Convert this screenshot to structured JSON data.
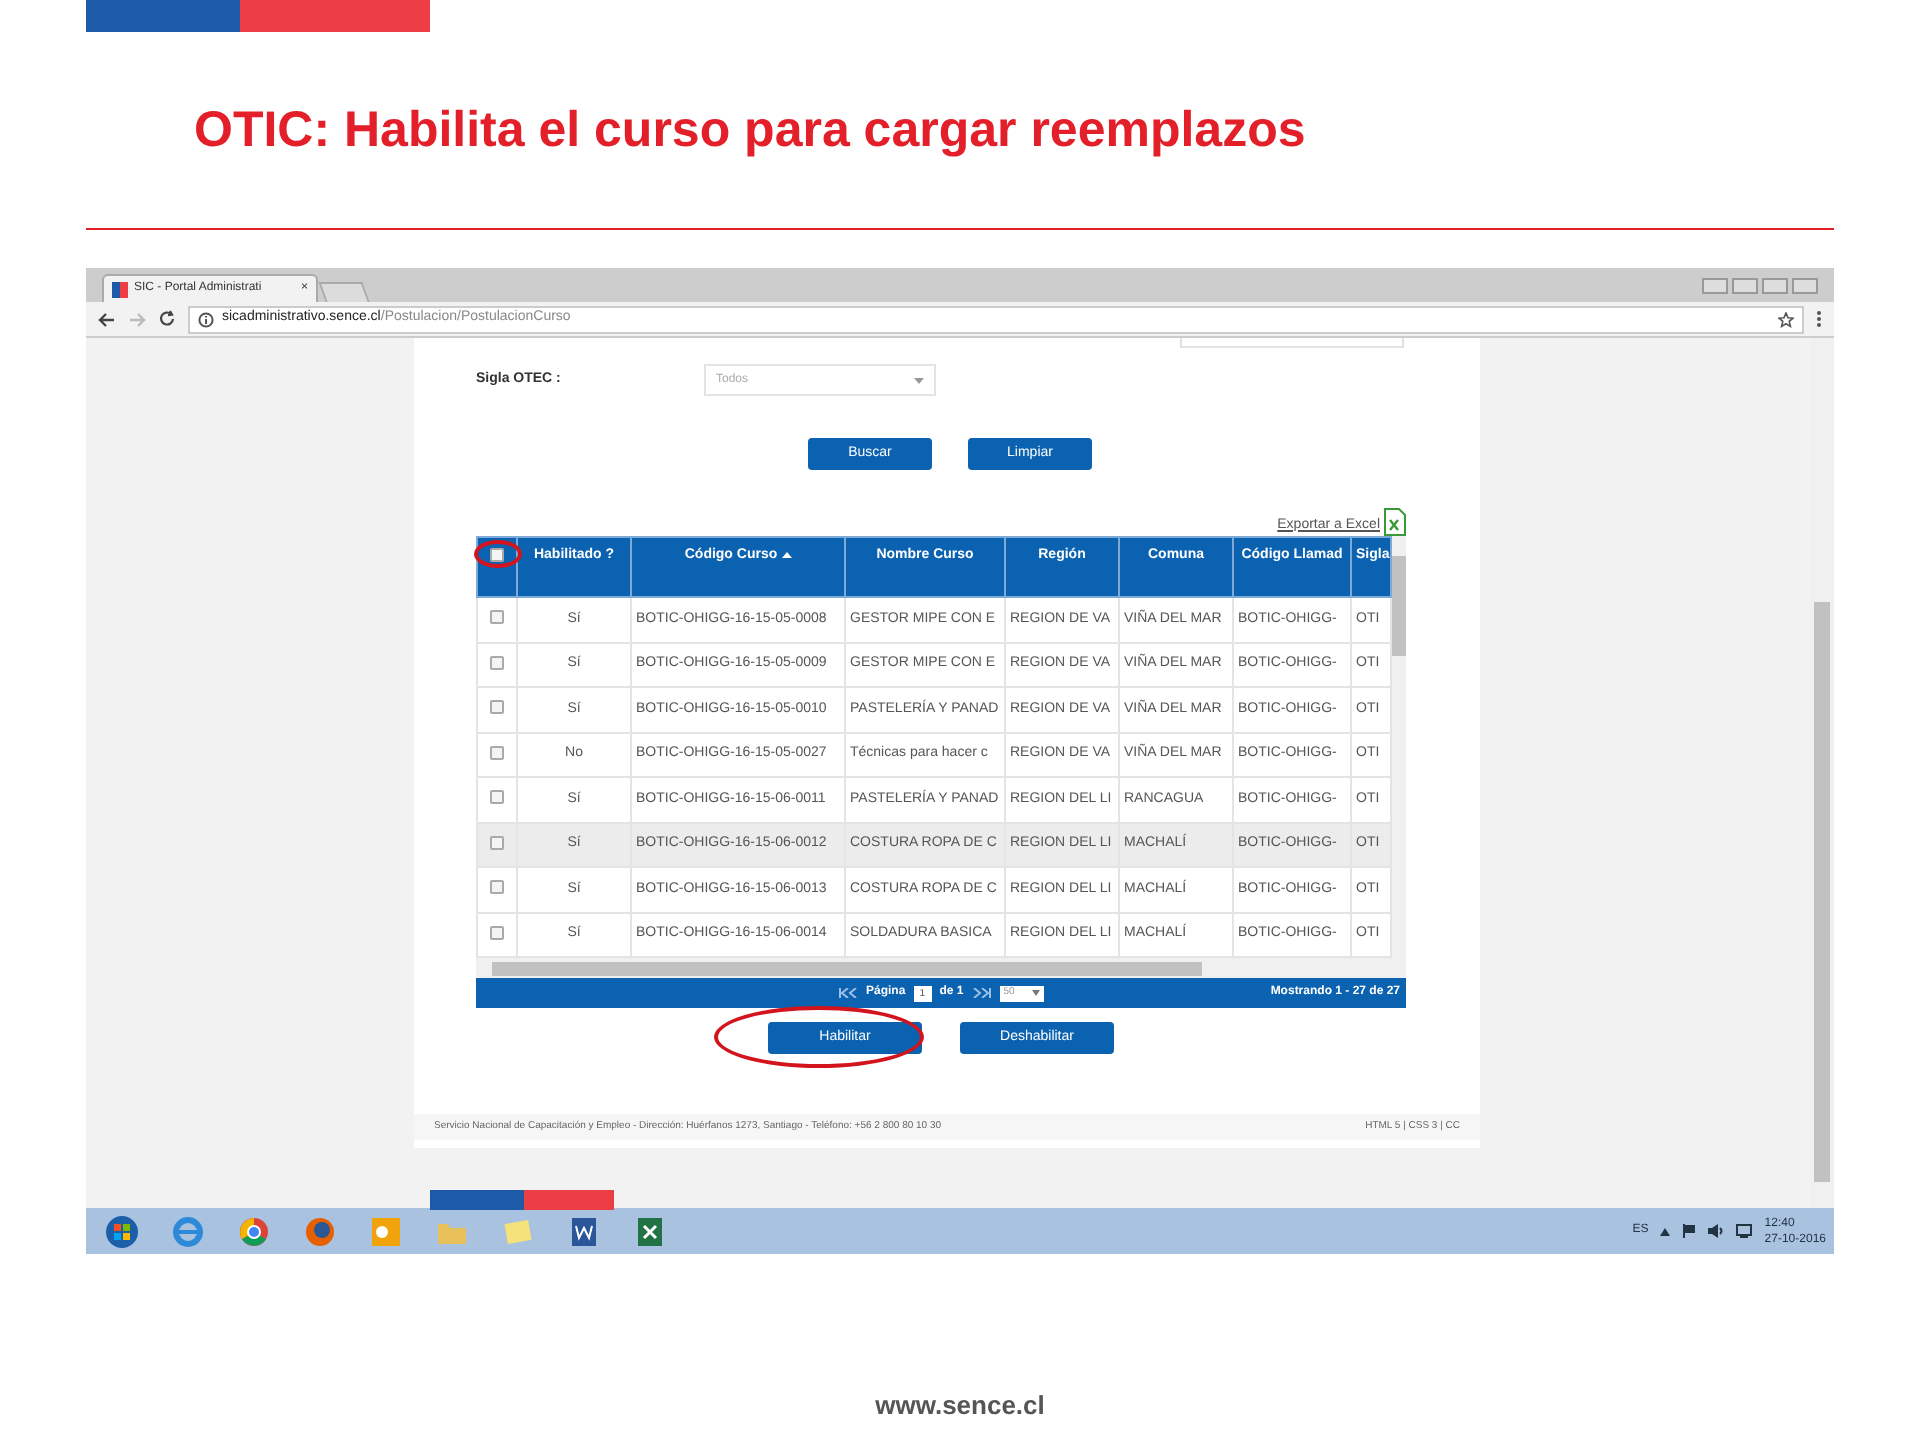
{
  "slide": {
    "title": "OTIC: Habilita el curso para cargar reemplazos",
    "footer": "www.sence.cl"
  },
  "browser": {
    "tab_title": "SIC - Portal Administrati",
    "tab_close": "×",
    "url_host": "sicadministrativo.sence.cl",
    "url_path": "/Postulacion/PostulacionCurso"
  },
  "filters": [
    {
      "label": "Sigla OTEC :",
      "value": "Todos"
    }
  ],
  "buttons": [
    {
      "label": "Buscar"
    },
    {
      "label": "Limpiar"
    }
  ],
  "export": {
    "label": "Exportar a Excel"
  },
  "table": {
    "select_all": {
      "checked": false,
      "circled": true
    },
    "columns": [
      {
        "label": "Habilitado ?",
        "sorted": false
      },
      {
        "label": "Código Curso",
        "sorted": true
      },
      {
        "label": "Nombre Curso",
        "sorted": false
      },
      {
        "label": "Región",
        "sorted": false
      },
      {
        "label": "Comuna",
        "sorted": false
      },
      {
        "label": "Código Llamad",
        "sorted": false
      },
      {
        "label": "Sigla",
        "sorted": false
      }
    ],
    "rows": [
      {
        "checked": false,
        "highlighted": false,
        "cells": [
          "Sí",
          "BOTIC-OHIGG-16-15-05-0008",
          "GESTOR MIPE CON E",
          "REGION DE VA",
          "VIÑA DEL MAR",
          "BOTIC-OHIGG-",
          "OTI"
        ]
      },
      {
        "checked": false,
        "highlighted": false,
        "cells": [
          "Sí",
          "BOTIC-OHIGG-16-15-05-0009",
          "GESTOR MIPE CON E",
          "REGION DE VA",
          "VIÑA DEL MAR",
          "BOTIC-OHIGG-",
          "OTI"
        ]
      },
      {
        "checked": false,
        "highlighted": false,
        "cells": [
          "Sí",
          "BOTIC-OHIGG-16-15-05-0010",
          "PASTELERÍA Y PANAD",
          "REGION DE VA",
          "VIÑA DEL MAR",
          "BOTIC-OHIGG-",
          "OTI"
        ]
      },
      {
        "checked": false,
        "highlighted": false,
        "cells": [
          "No",
          "BOTIC-OHIGG-16-15-05-0027",
          "Técnicas para hacer c",
          "REGION DE VA",
          "VIÑA DEL MAR",
          "BOTIC-OHIGG-",
          "OTI"
        ]
      },
      {
        "checked": false,
        "highlighted": false,
        "cells": [
          "Sí",
          "BOTIC-OHIGG-16-15-06-0011",
          "PASTELERÍA Y PANAD",
          "REGION DEL LI",
          "RANCAGUA",
          "BOTIC-OHIGG-",
          "OTI"
        ]
      },
      {
        "checked": false,
        "highlighted": true,
        "cells": [
          "Sí",
          "BOTIC-OHIGG-16-15-06-0012",
          "COSTURA ROPA DE C",
          "REGION DEL LI",
          "MACHALÍ",
          "BOTIC-OHIGG-",
          "OTI"
        ]
      },
      {
        "checked": false,
        "highlighted": false,
        "cells": [
          "Sí",
          "BOTIC-OHIGG-16-15-06-0013",
          "COSTURA ROPA DE C",
          "REGION DEL LI",
          "MACHALÍ",
          "BOTIC-OHIGG-",
          "OTI"
        ]
      },
      {
        "checked": false,
        "highlighted": false,
        "cells": [
          "Sí",
          "BOTIC-OHIGG-16-15-06-0014",
          "SOLDADURA BASICA",
          "REGION DEL LI",
          "MACHALÍ",
          "BOTIC-OHIGG-",
          "OTI"
        ]
      }
    ]
  },
  "pager": {
    "page_label": "Página",
    "page": "1",
    "of": "de 1",
    "page_size": "50",
    "summary": "Mostrando 1 - 27 de 27"
  },
  "actions": [
    {
      "label": "Habilitar",
      "circled": true
    },
    {
      "label": "Deshabilitar",
      "circled": false
    }
  ],
  "page_footer": {
    "address": "Servicio Nacional de Capacitación y Empleo - Dirección: Huérfanos 1273, Santiago - Teléfono: +56 2 800 80 10 30",
    "links": "HTML 5 | CSS 3 | CC"
  },
  "taskbar": {
    "language": "ES",
    "time": "12:40",
    "date": "27-10-2016"
  }
}
